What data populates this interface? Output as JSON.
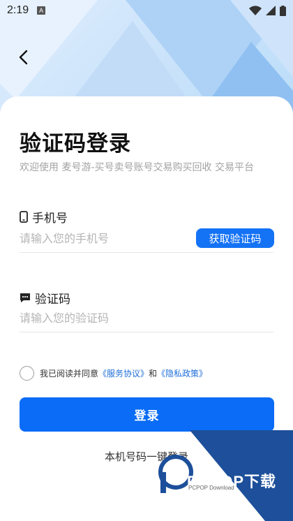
{
  "status_bar": {
    "time": "2:19",
    "notification_letter": "A"
  },
  "header": {
    "back_icon": "chevron-left-icon"
  },
  "page": {
    "title": "验证码登录",
    "subtitle": "欢迎使用 麦号游-买号卖号账号交易购买回收 交易平台"
  },
  "phone": {
    "label": "手机号",
    "icon": "phone-icon",
    "placeholder": "请输入您的手机号",
    "value": "",
    "get_code_label": "获取验证码"
  },
  "code": {
    "label": "验证码",
    "icon": "message-icon",
    "placeholder": "请输入您的验证码",
    "value": ""
  },
  "agreement": {
    "checked": false,
    "prefix": "我已阅读并同意",
    "service_link": "《服务协议》",
    "and": "和",
    "privacy_link": "《隐私政策》"
  },
  "login_label": "登录",
  "one_click_label": "本机号码一键登录",
  "watermark": {
    "brand": "PCPOP下载",
    "sub": "PCPOP Download"
  },
  "colors": {
    "primary": "#0a6cf7",
    "link": "#1f6fd8",
    "placeholder": "#b5b5b5",
    "watermark": "#1d4f9a"
  }
}
